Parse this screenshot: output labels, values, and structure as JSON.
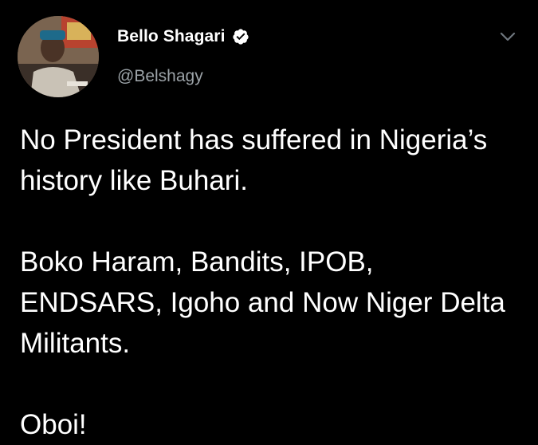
{
  "author": {
    "display_name": "Bello Shagari",
    "handle": "@Belshagy",
    "verified": true,
    "avatar_icon": "profile-photo"
  },
  "tweet": {
    "paragraphs": [
      "No President has suffered in Nigeria’s history like Buhari.",
      "Boko Haram, Bandits, IPOB, ENDSARS, Igoho and Now Niger Delta Militants.",
      "Oboi!"
    ]
  },
  "icons": {
    "verified": "verified-badge-icon",
    "more": "chevron-down-icon"
  },
  "colors": {
    "background": "#000000",
    "text": "#ffffff",
    "secondary_text": "#9ca3a8"
  }
}
